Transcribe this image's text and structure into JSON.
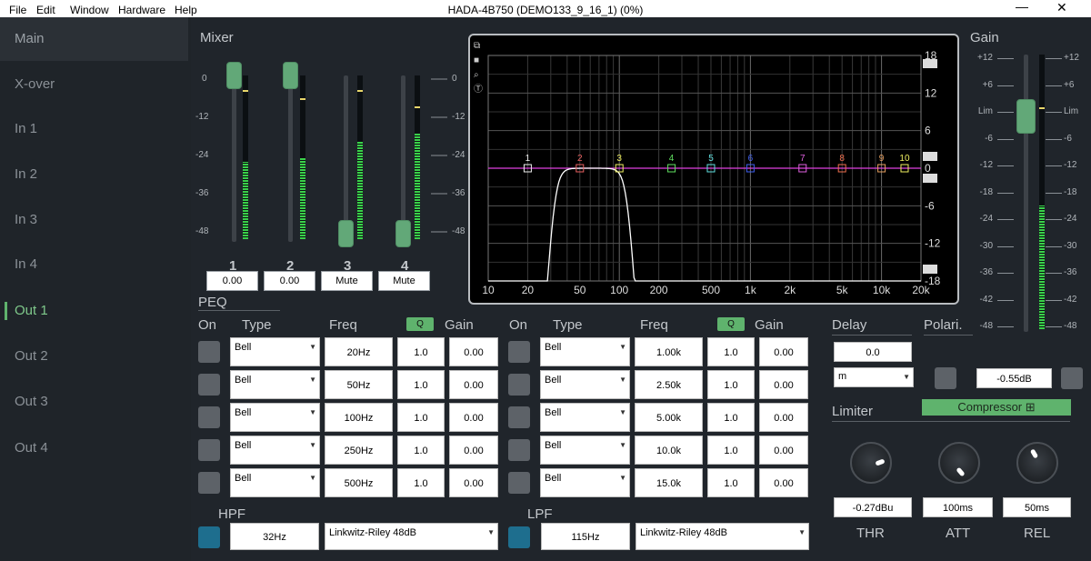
{
  "window": {
    "title": "HADA-4B750 (DEMO133_9_16_1) (0%)",
    "menu": [
      "File",
      "Edit",
      "Window",
      "Hardware",
      "Help"
    ],
    "minimize": "—",
    "close": "✕"
  },
  "sidebar": {
    "items": [
      {
        "label": "Main"
      },
      {
        "label": "X-over"
      },
      {
        "label": "In 1"
      },
      {
        "label": "In 2"
      },
      {
        "label": "In 3"
      },
      {
        "label": "In 4"
      },
      {
        "label": "Out 1"
      },
      {
        "label": "Out 2"
      },
      {
        "label": "Out 3"
      },
      {
        "label": "Out 4"
      }
    ],
    "selected": "Main",
    "active": "Out 1"
  },
  "mixer": {
    "title": "Mixer",
    "scale": [
      "0",
      "-12",
      "-24",
      "-36",
      "-48"
    ],
    "channels": [
      {
        "num": "1",
        "value": "0.00",
        "level": 0.47,
        "peak": 0.9
      },
      {
        "num": "2",
        "value": "0.00",
        "level": 0.5,
        "peak": 0.85
      },
      {
        "num": "3",
        "value": "Mute",
        "level": 0.6,
        "peak": 0.9
      },
      {
        "num": "4",
        "value": "Mute",
        "level": 0.65,
        "peak": 0.8
      }
    ]
  },
  "eq": {
    "x_ticks": [
      "10",
      "20",
      "50",
      "100",
      "200",
      "500",
      "1k",
      "2k",
      "5k",
      "10k",
      "20k"
    ],
    "y_ticks": [
      "18",
      "12",
      "6",
      "0",
      "-6",
      "-12",
      "-18"
    ],
    "bands": [
      {
        "n": "1",
        "color": "#f0f0f0"
      },
      {
        "n": "2",
        "color": "#e86060"
      },
      {
        "n": "3",
        "color": "#f0f060"
      },
      {
        "n": "4",
        "color": "#60e060"
      },
      {
        "n": "5",
        "color": "#60e0e0"
      },
      {
        "n": "6",
        "color": "#4060f0"
      },
      {
        "n": "7",
        "color": "#e060e0"
      },
      {
        "n": "8",
        "color": "#f07050"
      },
      {
        "n": "9",
        "color": "#e8a060"
      },
      {
        "n": "10",
        "color": "#f0f060"
      }
    ],
    "tools": [
      "restore-icon",
      "camera-icon",
      "zoom-icon",
      "text-icon"
    ]
  },
  "gain": {
    "title": "Gain",
    "scale": [
      "+12",
      "+6",
      "Lim",
      "-6",
      "-12",
      "-18",
      "-24",
      "-30",
      "-36",
      "-42",
      "-48"
    ],
    "level": 0.45,
    "peak": 0.8
  },
  "peq": {
    "title": "PEQ",
    "headers": {
      "on": "On",
      "type": "Type",
      "freq": "Freq",
      "q": "Q",
      "gain": "Gain"
    },
    "left": [
      {
        "type": "Bell",
        "freq": "20Hz",
        "q": "1.0",
        "gain": "0.00"
      },
      {
        "type": "Bell",
        "freq": "50Hz",
        "q": "1.0",
        "gain": "0.00"
      },
      {
        "type": "Bell",
        "freq": "100Hz",
        "q": "1.0",
        "gain": "0.00"
      },
      {
        "type": "Bell",
        "freq": "250Hz",
        "q": "1.0",
        "gain": "0.00"
      },
      {
        "type": "Bell",
        "freq": "500Hz",
        "q": "1.0",
        "gain": "0.00"
      }
    ],
    "right": [
      {
        "type": "Bell",
        "freq": "1.00k",
        "q": "1.0",
        "gain": "0.00"
      },
      {
        "type": "Bell",
        "freq": "2.50k",
        "q": "1.0",
        "gain": "0.00"
      },
      {
        "type": "Bell",
        "freq": "5.00k",
        "q": "1.0",
        "gain": "0.00"
      },
      {
        "type": "Bell",
        "freq": "10.0k",
        "q": "1.0",
        "gain": "0.00"
      },
      {
        "type": "Bell",
        "freq": "15.0k",
        "q": "1.0",
        "gain": "0.00"
      }
    ]
  },
  "hpf": {
    "label": "HPF",
    "freq": "32Hz",
    "type": "Linkwitz-Riley 48dB"
  },
  "lpf": {
    "label": "LPF",
    "freq": "115Hz",
    "type": "Linkwitz-Riley 48dB"
  },
  "delay": {
    "title": "Delay",
    "value": "0.0",
    "unit": "m"
  },
  "polarity": {
    "title": "Polari.",
    "gain_value": "-0.55dB"
  },
  "limiter": {
    "title": "Limiter",
    "compressor": "Compressor",
    "thr_value": "-0.27dBu",
    "att_value": "100ms",
    "rel_value": "50ms",
    "thr": "THR",
    "att": "ATT",
    "rel": "REL"
  },
  "colors": {
    "accent": "#5fb36d",
    "fader": "#62a878",
    "filter_on": "#1e6e8e"
  }
}
